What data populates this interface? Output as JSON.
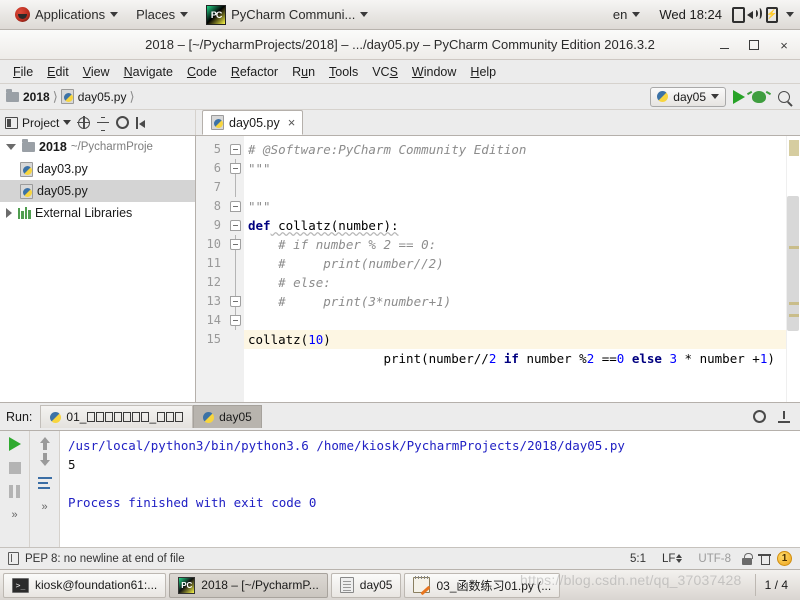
{
  "desktop": {
    "applications_menu": "Applications",
    "places_menu": "Places",
    "active_app": "PyCharm Communi...",
    "keyboard_layout": "en",
    "clock": "Wed 18:24",
    "icons": [
      "display-icon",
      "volume-icon",
      "battery-icon"
    ]
  },
  "window": {
    "title": "2018 – [~/PycharmProjects/2018] – .../day05.py – PyCharm Community Edition 2016.3.2",
    "minimize": "–",
    "maximize": "□",
    "close": "×"
  },
  "menubar": {
    "items": [
      {
        "label": "File",
        "mnemonic": "F"
      },
      {
        "label": "Edit",
        "mnemonic": "E"
      },
      {
        "label": "View",
        "mnemonic": "V"
      },
      {
        "label": "Navigate",
        "mnemonic": "N"
      },
      {
        "label": "Code",
        "mnemonic": "C"
      },
      {
        "label": "Refactor",
        "mnemonic": "R"
      },
      {
        "label": "Run",
        "mnemonic": "u"
      },
      {
        "label": "Tools",
        "mnemonic": "T"
      },
      {
        "label": "VCS",
        "mnemonic": "S"
      },
      {
        "label": "Window",
        "mnemonic": "W"
      },
      {
        "label": "Help",
        "mnemonic": "H"
      }
    ]
  },
  "navbar": {
    "crumbs": [
      "2018",
      "day05.py"
    ],
    "run_config": "day05",
    "run_button": "run-icon",
    "debug_button": "debug-icon",
    "search_button": "search-icon"
  },
  "toolstrip": {
    "project_label": "Project",
    "editor_tab": "day05.py",
    "tab_close": "×"
  },
  "project_tree": {
    "root": {
      "label": "2018",
      "path": "~/PycharmProje"
    },
    "files": [
      "day03.py",
      "day05.py"
    ],
    "selected": "day05.py",
    "external_libraries": "External Libraries"
  },
  "editor": {
    "first_line_number": 5,
    "lines": [
      {
        "n": 5,
        "text": "# @Software:PyCharm Community Edition"
      },
      {
        "n": 6,
        "text": "\"\"\""
      },
      {
        "n": 7,
        "text": ""
      },
      {
        "n": 8,
        "text": "\"\"\""
      },
      {
        "n": 9,
        "text": "def collatz(number):"
      },
      {
        "n": 10,
        "text": "    # if number % 2 == 0:"
      },
      {
        "n": 11,
        "text": "    #     print(number//2)"
      },
      {
        "n": 12,
        "text": "    # else:"
      },
      {
        "n": 13,
        "text": "    #     print(3*number+1)"
      },
      {
        "n": 14,
        "text": "    print(number//2 if number %2 ==0 else 3 * number +1)"
      },
      {
        "n": 15,
        "text": "collatz(10)"
      }
    ],
    "highlighted_line": 15,
    "intention_bulb_line": 14
  },
  "run_panel": {
    "label": "Run:",
    "tabs": [
      {
        "label_prefix": "01_",
        "tofu_count_1": 7,
        "label_mid": "_",
        "tofu_count_2": 3,
        "active": false
      },
      {
        "label": "day05",
        "active": true
      }
    ],
    "console": [
      {
        "text": "/usr/local/python3/bin/python3.6 /home/kiosk/PycharmProjects/2018/day05.py",
        "color": "blue"
      },
      {
        "text": "5",
        "color": "black"
      },
      {
        "text": "",
        "color": "black"
      },
      {
        "text": "Process finished with exit code 0",
        "color": "blue"
      }
    ],
    "side_buttons": [
      "run-icon",
      "stop-icon",
      "pause-icon",
      "expand-icon"
    ],
    "side_buttons_2": [
      "scroll-up-icon",
      "scroll-down-icon",
      "soft-wrap-icon",
      "expand-icon"
    ],
    "right_icons": [
      "settings-icon",
      "pin-icon"
    ]
  },
  "statusbar": {
    "message": "PEP 8: no newline at end of file",
    "caret": "5:1",
    "line_separator": "LF",
    "encoding": "UTF-8",
    "warning_count": "1"
  },
  "taskbar": {
    "items": [
      {
        "label": "kiosk@foundation61:...",
        "icon": "terminal-icon",
        "active": false
      },
      {
        "label": "2018 – [~/PycharmP...",
        "icon": "pycharm-icon",
        "active": true
      },
      {
        "label": "day05",
        "icon": "document-icon",
        "active": false
      },
      {
        "label": "03_函数练习01.py (...",
        "icon": "notepad-icon",
        "active": false
      }
    ],
    "workspace": "1 / 4",
    "watermark": "https://blog.csdn.net/qq_37037428"
  },
  "colors": {
    "accent_green": "#27a327",
    "keyword_blue": "#000080",
    "number_blue": "#0000ff",
    "comment_gray": "#8c8c8c",
    "console_blue": "#2121c4",
    "warning_orange": "#eda51e"
  }
}
